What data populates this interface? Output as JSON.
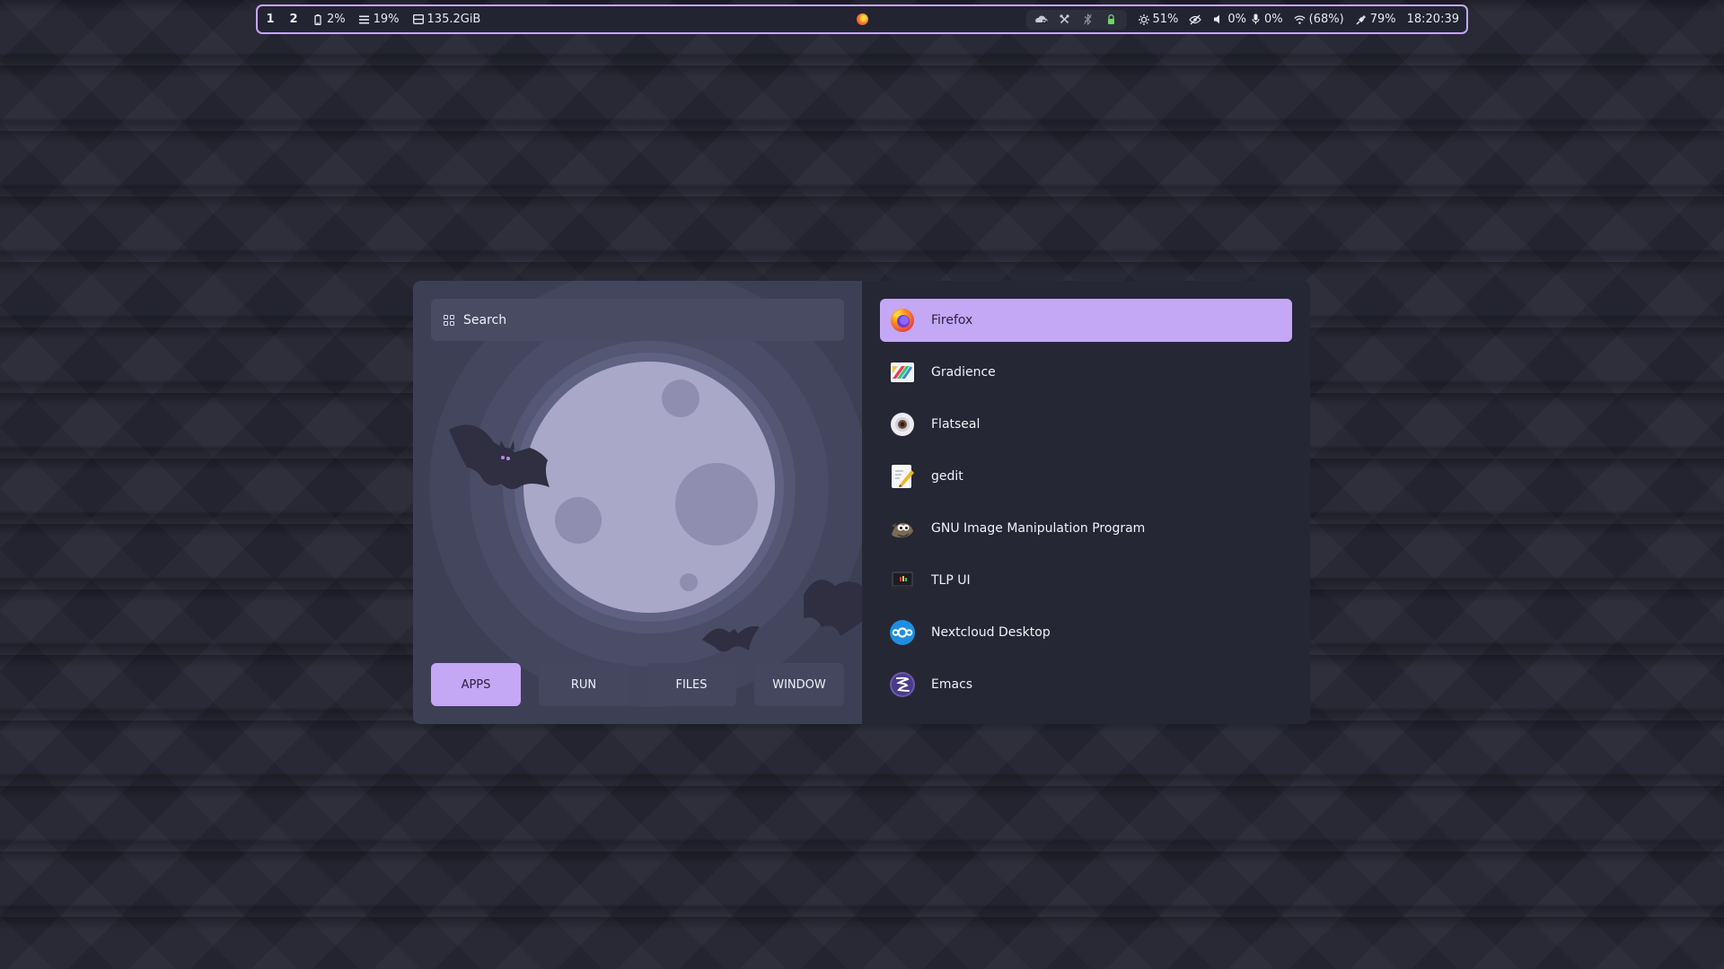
{
  "topbar": {
    "workspaces": [
      "1",
      "2"
    ],
    "battery": "2%",
    "memory": "19%",
    "disk": "135.2GiB",
    "tray_icons": [
      "cloud-icon",
      "tools-icon",
      "bluetooth-icon",
      "lock-icon"
    ],
    "brightness": "51%",
    "volume": "0%",
    "mic": "0%",
    "wifi": "(68%)",
    "power": "79%",
    "clock": "18:20:39"
  },
  "launcher": {
    "search": {
      "placeholder": "Search"
    },
    "modes": [
      {
        "label": "APPS",
        "active": true
      },
      {
        "label": "RUN",
        "active": false
      },
      {
        "label": "FILES",
        "active": false
      },
      {
        "label": "WINDOW",
        "active": false
      }
    ],
    "apps": [
      {
        "name": "Firefox",
        "icon": "firefox-icon",
        "selected": true
      },
      {
        "name": "Gradience",
        "icon": "gradience-icon",
        "selected": false
      },
      {
        "name": "Flatseal",
        "icon": "flatseal-icon",
        "selected": false
      },
      {
        "name": "gedit",
        "icon": "gedit-icon",
        "selected": false
      },
      {
        "name": "GNU Image Manipulation Program",
        "icon": "gimp-icon",
        "selected": false
      },
      {
        "name": "TLP UI",
        "icon": "tlp-ui-icon",
        "selected": false
      },
      {
        "name": "Nextcloud Desktop",
        "icon": "nextcloud-icon",
        "selected": false
      },
      {
        "name": "Emacs",
        "icon": "emacs-icon",
        "selected": false
      }
    ]
  },
  "colors": {
    "accent": "#c4a7f5",
    "background": "#262735",
    "panel": "#3d3f55",
    "moon": "#a9a8c8"
  }
}
